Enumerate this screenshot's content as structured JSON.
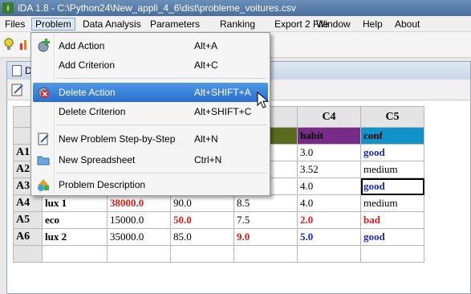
{
  "window": {
    "title": "iDA 1.8 - C:\\Python24\\New_appli_4_6\\dist\\probleme_voitures.csv"
  },
  "menubar": [
    "Files",
    "Problem",
    "Data Analysis",
    "Parameters",
    "Ranking",
    "Export 2 File",
    "Window",
    "Help",
    "About"
  ],
  "mdi": {
    "title": "D"
  },
  "dropdown": {
    "items": [
      {
        "label": "Add Action",
        "shortcut": "Alt+A"
      },
      {
        "label": "Add Criterion",
        "shortcut": "Alt+C"
      },
      {
        "label": "Delete Action",
        "shortcut": "Alt+SHIFT+A"
      },
      {
        "label": "Delete Criterion",
        "shortcut": "Alt+SHIFT+C"
      },
      {
        "label": "New Problem Step-by-Step",
        "shortcut": "Alt+N"
      },
      {
        "label": "New Spreadsheet",
        "shortcut": "Ctrl+N"
      },
      {
        "label": "Problem Description",
        "shortcut": ""
      }
    ]
  },
  "grid": {
    "col_headers": [
      "C4",
      "C5"
    ],
    "criteria_names": [
      "habit",
      "conf"
    ],
    "rows": [
      {
        "id": "A1",
        "name": "",
        "c1": "",
        "c2": "",
        "c3": "",
        "c4": "3.0",
        "c5": "good"
      },
      {
        "id": "A2",
        "name": "",
        "c1": "",
        "c2": "",
        "c3": "",
        "c4": "3.52",
        "c5": "medium"
      },
      {
        "id": "A3",
        "name": "",
        "c1": "",
        "c2": "",
        "c3": "",
        "c4": "4.0",
        "c5": "good"
      },
      {
        "id": "A4",
        "name": "lux 1",
        "c1": "38000.0",
        "c2": "90.0",
        "c3": "8.5",
        "c4": "4.0",
        "c5": "medium"
      },
      {
        "id": "A5",
        "name": "eco",
        "c1": "15000.0",
        "c2": "50.0",
        "c3": "7.5",
        "c4": "2.0",
        "c5": "bad"
      },
      {
        "id": "A6",
        "name": "lux 2",
        "c1": "35000.0",
        "c2": "85.0",
        "c3": "9.0",
        "c4": "5.0",
        "c5": "good"
      }
    ]
  },
  "colors": {
    "highlight": "#2a6fce",
    "best_value": "#e11b1b",
    "worst_value": "#1a28c8",
    "habit_header": "#7a2a88",
    "conf_header": "#0f93c8"
  }
}
